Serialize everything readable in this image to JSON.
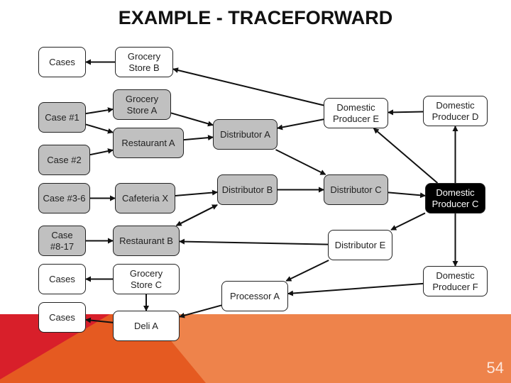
{
  "title": "EXAMPLE - TRACEFORWARD",
  "page_number": "54",
  "colors": {
    "gray_node": "#c0c0c0",
    "white_node": "#ffffff",
    "black_node": "#000000",
    "band_orange": "#ee834b",
    "band_red": "#d81f2a",
    "band_dark_orange": "#e55a21"
  },
  "nodes": {
    "cases_top": {
      "label": "Cases",
      "style": "white"
    },
    "grocery_b": {
      "label": "Grocery\nStore B",
      "style": "white"
    },
    "case1": {
      "label": "Case #1",
      "style": "gray"
    },
    "grocery_a": {
      "label": "Grocery\nStore A",
      "style": "gray"
    },
    "restaurant_a": {
      "label": "Restaurant A",
      "style": "gray"
    },
    "distributor_a": {
      "label": "Distributor A",
      "style": "gray"
    },
    "producer_e": {
      "label": "Domestic\nProducer E",
      "style": "white"
    },
    "producer_d": {
      "label": "Domestic\nProducer D",
      "style": "white"
    },
    "case2": {
      "label": "Case #2",
      "style": "gray"
    },
    "case3_6": {
      "label": "Case #3-6",
      "style": "gray"
    },
    "cafeteria_x": {
      "label": "Cafeteria X",
      "style": "gray"
    },
    "distributor_b": {
      "label": "Distributor B",
      "style": "gray"
    },
    "distributor_c": {
      "label": "Distributor C",
      "style": "gray"
    },
    "producer_c": {
      "label": "Domestic\nProducer C",
      "style": "black"
    },
    "case8_17": {
      "label": "Case\n#8-17",
      "style": "gray"
    },
    "restaurant_b": {
      "label": "Restaurant B",
      "style": "gray"
    },
    "distributor_e": {
      "label": "Distributor E",
      "style": "white"
    },
    "cases_mid": {
      "label": "Cases",
      "style": "white"
    },
    "grocery_c": {
      "label": "Grocery\nStore C",
      "style": "white"
    },
    "producer_f": {
      "label": "Domestic\nProducer F",
      "style": "white"
    },
    "processor_a": {
      "label": "Processor A",
      "style": "white"
    },
    "cases_bottom": {
      "label": "Cases",
      "style": "white"
    },
    "deli_a": {
      "label": "Deli A",
      "style": "white"
    }
  },
  "edges": [
    {
      "from": "grocery_b",
      "to": "cases_top"
    },
    {
      "from": "producer_e",
      "to": "grocery_b"
    },
    {
      "from": "case1",
      "to": "grocery_a"
    },
    {
      "from": "case1",
      "to": "restaurant_a"
    },
    {
      "from": "case2",
      "to": "restaurant_a"
    },
    {
      "from": "grocery_a",
      "to": "distributor_a"
    },
    {
      "from": "restaurant_a",
      "to": "distributor_a"
    },
    {
      "from": "producer_e",
      "to": "distributor_a"
    },
    {
      "from": "producer_d",
      "to": "producer_e"
    },
    {
      "from": "producer_c",
      "to": "producer_e"
    },
    {
      "from": "producer_c",
      "to": "producer_d"
    },
    {
      "from": "distributor_a",
      "to": "distributor_c"
    },
    {
      "from": "case3_6",
      "to": "cafeteria_x"
    },
    {
      "from": "cafeteria_x",
      "to": "distributor_b"
    },
    {
      "from": "restaurant_b",
      "to": "distributor_b"
    },
    {
      "from": "distributor_b",
      "to": "restaurant_b"
    },
    {
      "from": "distributor_b",
      "to": "distributor_c"
    },
    {
      "from": "distributor_c",
      "to": "producer_c"
    },
    {
      "from": "producer_c",
      "to": "distributor_e"
    },
    {
      "from": "producer_c",
      "to": "producer_f"
    },
    {
      "from": "case8_17",
      "to": "restaurant_b"
    },
    {
      "from": "distributor_e",
      "to": "restaurant_b"
    },
    {
      "from": "distributor_e",
      "to": "processor_a"
    },
    {
      "from": "producer_f",
      "to": "processor_a"
    },
    {
      "from": "grocery_c",
      "to": "cases_mid"
    },
    {
      "from": "grocery_c",
      "to": "deli_a"
    },
    {
      "from": "processor_a",
      "to": "deli_a"
    },
    {
      "from": "deli_a",
      "to": "cases_bottom"
    }
  ]
}
